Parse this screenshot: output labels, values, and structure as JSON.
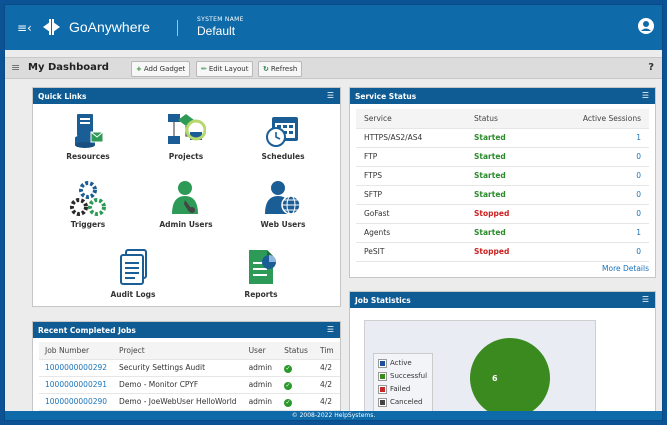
{
  "app": {
    "brand": "GoAnywhere",
    "system_name_label": "SYSTEM NAME",
    "system_name": "Default"
  },
  "toolbar": {
    "title": "My Dashboard",
    "add_gadget": "Add Gadget",
    "edit_layout": "Edit Layout",
    "refresh": "Refresh",
    "help": "?"
  },
  "quick_links": {
    "title": "Quick Links",
    "items": [
      {
        "label": "Resources",
        "icon": "resources-icon"
      },
      {
        "label": "Projects",
        "icon": "projects-icon"
      },
      {
        "label": "Schedules",
        "icon": "schedules-icon"
      },
      {
        "label": "Triggers",
        "icon": "triggers-icon"
      },
      {
        "label": "Admin Users",
        "icon": "admin-users-icon"
      },
      {
        "label": "Web Users",
        "icon": "web-users-icon"
      },
      {
        "label": "Audit Logs",
        "icon": "audit-logs-icon"
      },
      {
        "label": "Reports",
        "icon": "reports-icon"
      }
    ]
  },
  "service_status": {
    "title": "Service Status",
    "columns": [
      "Service",
      "Status",
      "Active Sessions"
    ],
    "rows": [
      {
        "service": "HTTPS/AS2/AS4",
        "status": "Started",
        "sessions": "1"
      },
      {
        "service": "FTP",
        "status": "Started",
        "sessions": "0"
      },
      {
        "service": "FTPS",
        "status": "Started",
        "sessions": "0"
      },
      {
        "service": "SFTP",
        "status": "Started",
        "sessions": "0"
      },
      {
        "service": "GoFast",
        "status": "Stopped",
        "sessions": "0"
      },
      {
        "service": "Agents",
        "status": "Started",
        "sessions": "1"
      },
      {
        "service": "PeSIT",
        "status": "Stopped",
        "sessions": "0"
      }
    ],
    "more_link": "More Details",
    "colors": {
      "started": "#2b8a2b",
      "stopped": "#cc1f1f"
    }
  },
  "recent_jobs": {
    "title": "Recent Completed Jobs",
    "columns": [
      "Job Number",
      "Project",
      "User",
      "Status",
      "Tim"
    ],
    "rows": [
      {
        "job": "1000000000292",
        "project": "Security Settings Audit",
        "user": "admin",
        "time": "4/2"
      },
      {
        "job": "1000000000291",
        "project": "Demo - Monitor CPYF",
        "user": "admin",
        "time": "4/2"
      },
      {
        "job": "1000000000290",
        "project": "Demo - JoeWebUser HelloWorld",
        "user": "admin",
        "time": "4/2"
      }
    ]
  },
  "job_statistics": {
    "title": "Job Statistics",
    "legend": [
      {
        "label": "Active",
        "color": "#1f4e9c"
      },
      {
        "label": "Successful",
        "color": "#3a8a1f"
      },
      {
        "label": "Failed",
        "color": "#c62828"
      },
      {
        "label": "Canceled",
        "color": "#444444"
      }
    ],
    "pie_label": "6"
  },
  "chart_data": {
    "type": "pie",
    "categories": [
      "Active",
      "Successful",
      "Failed",
      "Canceled"
    ],
    "values": [
      0,
      6,
      0,
      0
    ],
    "legend_position": "left"
  },
  "footer": {
    "copyright": "© 2008-2022 HelpSystems."
  }
}
